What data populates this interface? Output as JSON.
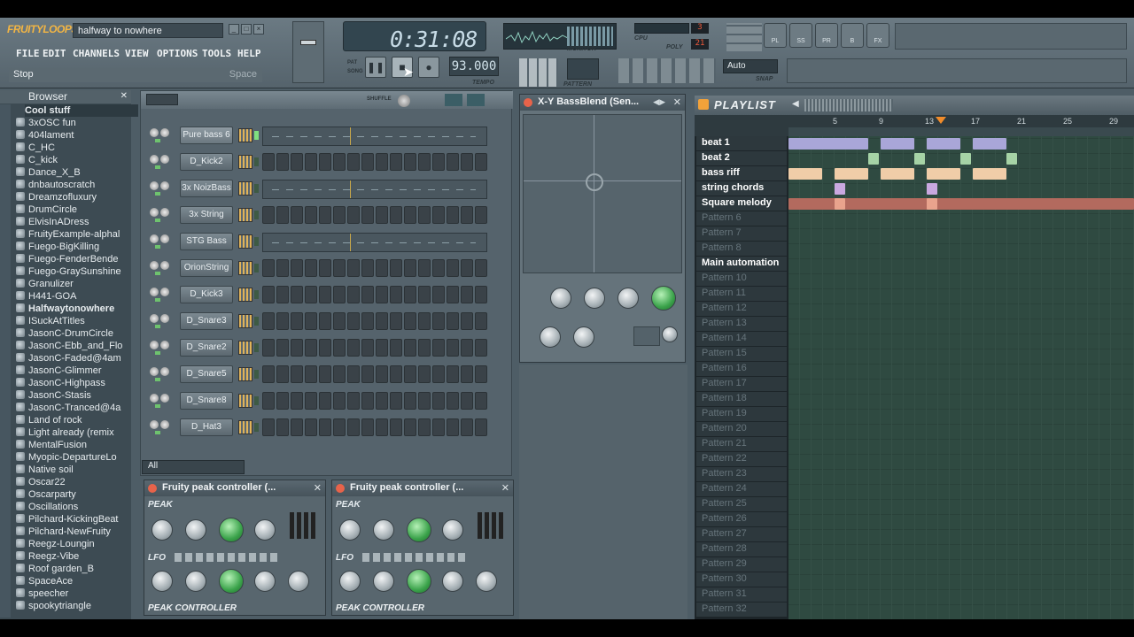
{
  "app": {
    "logo": "FRUITYLOOPS",
    "song_title": "halfway to nowhere",
    "menu": [
      "FILE",
      "EDIT",
      "CHANNELS",
      "VIEW",
      "OPTIONS",
      "TOOLS",
      "HELP"
    ],
    "hint_text": "Stop",
    "hint_key": "Space",
    "time": "0:31:08",
    "tempo": "93.000",
    "tempo_label": "TEMPO",
    "pattern_label": "PATTERN",
    "monitor_label": "MONITOR",
    "cpu_label": "CPU",
    "poly_label": "POLY",
    "poly_value": "21",
    "snap_label": "SNAP",
    "snap_value": "Auto",
    "tools": [
      "PL",
      "SS",
      "PR",
      "B",
      "FX"
    ]
  },
  "browser": {
    "title": "Browser",
    "items": [
      "Cool stuff",
      "3xOSC fun",
      "404lament",
      "C_HC",
      "C_kick",
      "Dance_X_B",
      "dnbautoscratch",
      "Dreamzofluxury",
      "DrumCircle",
      "ElvisInADress",
      "FruityExample-alphal",
      "Fuego-BigKilling",
      "Fuego-FenderBende",
      "Fuego-GraySunshine",
      "Granulizer",
      "H441-GOA",
      "Halfwaytonowhere",
      "ISuckAtTitles",
      "JasonC-DrumCircle",
      "JasonC-Ebb_and_Flo",
      "JasonC-Faded@4am",
      "JasonC-Glimmer",
      "JasonC-Highpass",
      "JasonC-Stasis",
      "JasonC-Tranced@4a",
      "Land of rock",
      "Light already (remix",
      "MentalFusion",
      "Myopic-DepartureLo",
      "Native soil",
      "Oscar22",
      "Oscarparty",
      "Oscillations",
      "Pilchard-KickingBeat",
      "Pilchard-NewFruity",
      "Reegz-Loungin",
      "Reegz-Vibe",
      "Roof garden_B",
      "SpaceAce",
      "speecher",
      "spookytriangle"
    ]
  },
  "channels": {
    "filter": "All",
    "items": [
      {
        "name": "Pure bass 6",
        "type": "graph",
        "active": true
      },
      {
        "name": "D_Kick2",
        "type": "steps"
      },
      {
        "name": "3x NoizBass",
        "type": "graph"
      },
      {
        "name": "3x String",
        "type": "steps"
      },
      {
        "name": "STG Bass",
        "type": "graph"
      },
      {
        "name": "OrionString",
        "type": "steps"
      },
      {
        "name": "D_Kick3",
        "type": "steps"
      },
      {
        "name": "D_Snare3",
        "type": "steps"
      },
      {
        "name": "D_Snare2",
        "type": "steps"
      },
      {
        "name": "D_Snare5",
        "type": "steps"
      },
      {
        "name": "D_Snare8",
        "type": "steps"
      },
      {
        "name": "D_Hat3",
        "type": "steps"
      }
    ]
  },
  "xy": {
    "title": "X-Y BassBlend (Sen..."
  },
  "peaks": [
    {
      "title": "Fruity peak controller (...",
      "section1": "PEAK",
      "section2": "LFO",
      "footer": "PEAK CONTROLLER"
    },
    {
      "title": "Fruity peak controller (...",
      "section1": "PEAK",
      "section2": "LFO",
      "footer": "PEAK CONTROLLER"
    }
  ],
  "playlist": {
    "title": "PLAYLIST",
    "ruler": [
      "5",
      "9",
      "13",
      "17",
      "21",
      "25",
      "29"
    ],
    "tracks": [
      "beat 1",
      "beat 2",
      "bass riff",
      "string chords",
      "Square melody",
      "Pattern 6",
      "Pattern 7",
      "Pattern 8",
      "Main automation",
      "Pattern 10",
      "Pattern 11",
      "Pattern 12",
      "Pattern 13",
      "Pattern 14",
      "Pattern 15",
      "Pattern 16",
      "Pattern 17",
      "Pattern 18",
      "Pattern 19",
      "Pattern 20",
      "Pattern 21",
      "Pattern 22",
      "Pattern 23",
      "Pattern 24",
      "Pattern 25",
      "Pattern 26",
      "Pattern 27",
      "Pattern 28",
      "Pattern 29",
      "Pattern 30",
      "Pattern 31",
      "Pattern 32"
    ],
    "colors": {
      "beat1": "#a9a6d8",
      "beat2": "#a6d3a6",
      "bass": "#f0cda8",
      "strings": "#c9a8e0",
      "melody": "#b36a5e"
    }
  }
}
